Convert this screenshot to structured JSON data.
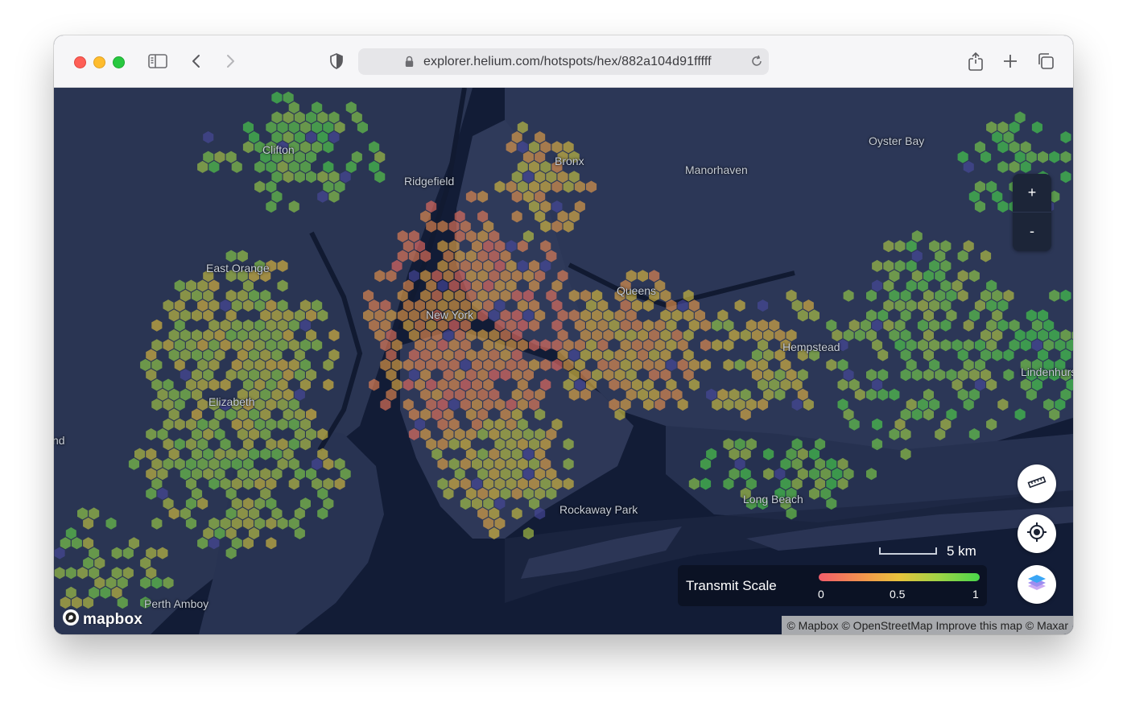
{
  "browser": {
    "url": "explorer.helium.com/hotspots/hex/882a104d91fffff"
  },
  "map": {
    "places": [
      {
        "name": "Clifton"
      },
      {
        "name": "Bronx"
      },
      {
        "name": "Ridgefield"
      },
      {
        "name": "Manorhaven"
      },
      {
        "name": "Oyster Bay"
      },
      {
        "name": "East Orange"
      },
      {
        "name": "Queens"
      },
      {
        "name": "New York"
      },
      {
        "name": "Hempstead"
      },
      {
        "name": "Lindenhurst"
      },
      {
        "name": "Elizabeth"
      },
      {
        "name": "nd"
      },
      {
        "name": "Long Beach"
      },
      {
        "name": "Rockaway Park"
      },
      {
        "name": "Perth Amboy"
      }
    ],
    "zoom_in_label": "+",
    "zoom_out_label": "-",
    "scale_label": "5 km",
    "legend": {
      "title": "Transmit Scale",
      "ticks": [
        "0",
        "0.5",
        "1"
      ],
      "colors": [
        "#f25c6a",
        "#e8c33c",
        "#49d64a"
      ]
    },
    "logo_text": "mapbox",
    "attribution": {
      "mapbox": "© Mapbox",
      "osm": "© OpenStreetMap",
      "improve": "Improve this map",
      "maxar": "© Maxar"
    },
    "buttons": [
      "ruler-icon",
      "locate-icon",
      "layers-icon"
    ]
  }
}
